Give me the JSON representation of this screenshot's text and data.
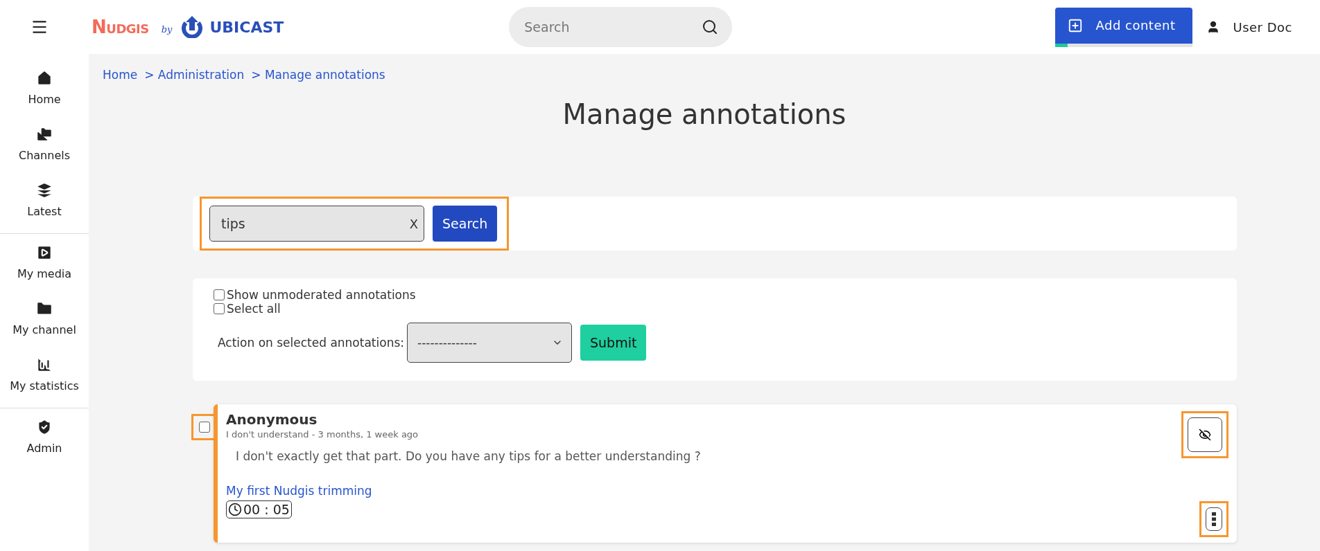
{
  "header": {
    "logo": {
      "brand": "Nudgis",
      "by": "by",
      "company": "UBICAST"
    },
    "search": {
      "placeholder": "Search"
    },
    "add_content": {
      "label": "Add content",
      "level": 0.09
    },
    "user": "User Doc"
  },
  "sidebar": {
    "groups": [
      [
        {
          "label": "Home"
        },
        {
          "label": "Channels"
        },
        {
          "label": "Latest"
        }
      ],
      [
        {
          "label": "My media"
        },
        {
          "label": "My channel"
        },
        {
          "label": "My statistics"
        }
      ],
      [
        {
          "label": "Admin"
        }
      ]
    ]
  },
  "breadcrumb": [
    "Home",
    "> Administration",
    "> Manage annotations"
  ],
  "title": "Manage annotations",
  "search_form": {
    "value": "tips",
    "clear": "X",
    "button": "Search",
    "highlighted": true
  },
  "filters": {
    "options": [
      {
        "label": "Show unmoderated annotations",
        "checked": false
      },
      {
        "label": "Select all",
        "checked": false
      }
    ],
    "action_label": "Action on selected annotations:",
    "action_value": "--------------",
    "submit": "Submit"
  },
  "annotations": [
    {
      "author": "Anonymous",
      "meta": "I don't understand - 3 months, 1 week ago",
      "text": "I don't exactly get that part. Do you have any tips for a better understanding ?",
      "media": "My first Nudgis trimming",
      "time": "00 : 05",
      "checked": false,
      "highlighted": true
    }
  ]
}
